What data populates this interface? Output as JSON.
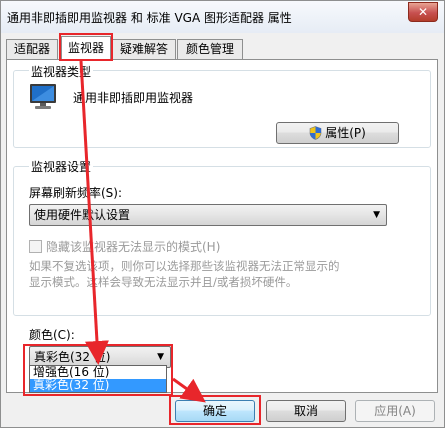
{
  "window": {
    "title": "通用非即插即用监视器 和 标准 VGA 图形适配器 属性",
    "close_glyph": "✕"
  },
  "tabs": [
    {
      "label": "适配器",
      "active": false
    },
    {
      "label": "监视器",
      "active": true
    },
    {
      "label": "疑难解答",
      "active": false
    },
    {
      "label": "颜色管理",
      "active": false
    }
  ],
  "monitor_type": {
    "group_label": "监视器类型",
    "monitor_name": "通用非即插即用监视器",
    "properties_button": "属性(P)"
  },
  "monitor_settings": {
    "group_label": "监视器设置",
    "refresh_label": "屏幕刷新频率(S):",
    "refresh_value": "使用硬件默认设置",
    "hide_modes_label": "隐藏该监视器无法显示的模式(H)",
    "hide_modes_checked": false,
    "warning_text_line1": "如果不复选该项，则你可以选择那些该监视器无法正常显示的",
    "warning_text_line2": "显示模式。这样会导致无法显示并且/或者损坏硬件。"
  },
  "colors": {
    "label": "颜色(C):",
    "selected_value": "真彩色(32 位)",
    "options": [
      "增强色(16 位)",
      "真彩色(32 位)"
    ],
    "highlighted_option": "真彩色(32 位)"
  },
  "footer": {
    "ok_button": "确定",
    "cancel_button": "取消",
    "apply_button": "应用(A)"
  },
  "annotation": {
    "color": "#e8262b"
  }
}
